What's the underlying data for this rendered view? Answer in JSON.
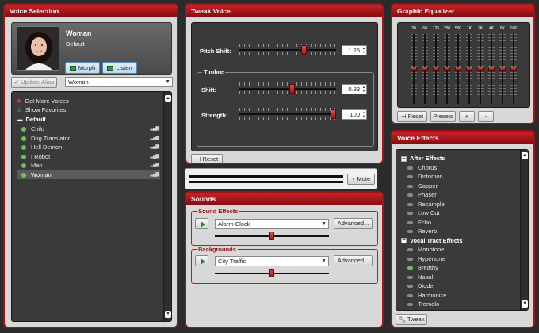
{
  "voice_selection": {
    "title": "Voice Selection",
    "voice_name": "Woman",
    "voice_type": "Default",
    "morph_label": "Morph",
    "listen_label": "Listen",
    "update_alias_label": "Update Alias",
    "alias_value": "Woman",
    "list": {
      "get_more": "Get More Voices",
      "show_favorites": "Show Favorites",
      "group": "Default",
      "items": [
        "Child",
        "Dog Translator",
        "Hell Demon",
        "I Robot",
        "Man",
        "Woman"
      ],
      "selected": "Woman"
    }
  },
  "tweak_voice": {
    "title": "Tweak Voice",
    "pitch_label": "Pitch Shift:",
    "pitch_value": "1.25",
    "pitch_level": 0.68,
    "timbre_label": "Timbre",
    "shift_label": "Shift:",
    "shift_value": "0.33",
    "shift_level": 0.55,
    "strength_label": "Strength:",
    "strength_value": "100",
    "strength_level": 1.0,
    "reset_label": "Reset"
  },
  "output": {
    "mute_label": "Mute"
  },
  "sounds": {
    "title": "Sounds",
    "effects_label": "Sound Effects",
    "effects_value": "Alarm Clock",
    "effects_advanced": "Advanced...",
    "effects_level": 0.5,
    "backgrounds_label": "Backgrounds",
    "backgrounds_value": "City Traffic",
    "backgrounds_advanced": "Advanced...",
    "backgrounds_level": 0.5
  },
  "equalizer": {
    "title": "Graphic Equalizer",
    "bands": [
      "30",
      "60",
      "125",
      "250",
      "500",
      "1K",
      "2K",
      "4K",
      "8K",
      "16K"
    ],
    "reset_label": "Reset",
    "presets_label": "Presets",
    "add_label": "+",
    "remove_label": "-"
  },
  "voice_effects": {
    "title": "Voice Effects",
    "after_header": "After Effects",
    "after_items": [
      "Chorus",
      "Distortion",
      "Gapper",
      "Phaser",
      "Resample",
      "Low Cut",
      "Echo",
      "Reverb"
    ],
    "vocal_header": "Vocal Tract Effects",
    "vocal_items": [
      "Monotone",
      "Hypertone",
      "Breathy",
      "Nasal",
      "Diode",
      "Harmonize",
      "Tremolo"
    ],
    "enabled": [
      "Breathy"
    ],
    "tweak_label": "Tweak"
  },
  "colors": {
    "accent": "#a01416",
    "panel_bg": "#d8d8d8",
    "dark_bg": "#3a3a3a",
    "active_green": "#6fbf5a"
  }
}
